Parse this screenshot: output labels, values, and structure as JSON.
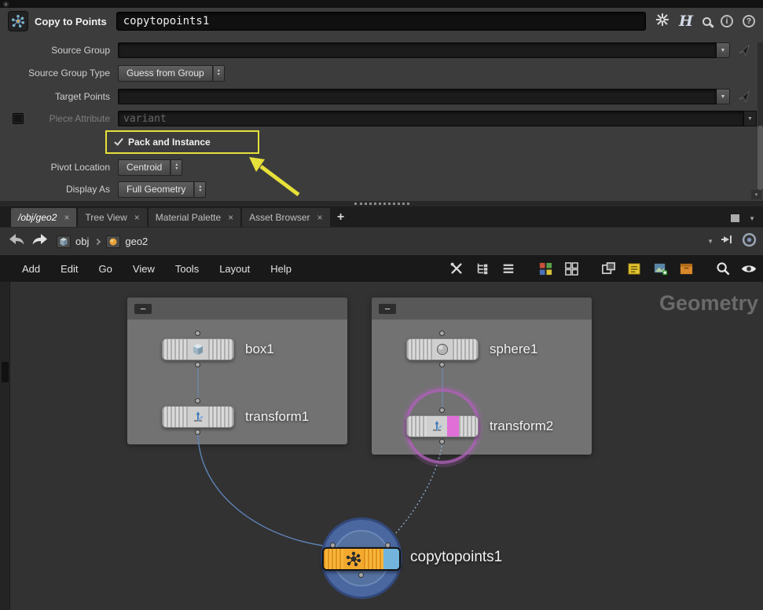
{
  "header": {
    "type_label": "Copy to Points",
    "name_value": "copytopoints1"
  },
  "parameters": {
    "source_group": {
      "label": "Source Group",
      "value": ""
    },
    "source_group_type": {
      "label": "Source Group Type",
      "value": "Guess from Group"
    },
    "target_points": {
      "label": "Target Points",
      "value": ""
    },
    "piece_attribute": {
      "label": "Piece Attribute",
      "value": "variant"
    },
    "pack_and_instance": {
      "label": "Pack and Instance",
      "checked": true
    },
    "pivot_location": {
      "label": "Pivot Location",
      "value": "Centroid"
    },
    "display_as": {
      "label": "Display As",
      "value": "Full Geometry"
    }
  },
  "glyphs": {
    "dropdown": "▼",
    "spin_up": "▴",
    "spin_down": "▾",
    "close": "×",
    "plus": "+",
    "minus": "−"
  },
  "tabs": {
    "items": [
      {
        "label": "/obj/geo2",
        "active": true
      },
      {
        "label": "Tree View",
        "active": false
      },
      {
        "label": "Material Palette",
        "active": false
      },
      {
        "label": "Asset Browser",
        "active": false
      }
    ]
  },
  "path_bar": {
    "segments": [
      {
        "label": "obj"
      },
      {
        "label": "geo2"
      }
    ]
  },
  "menu": {
    "items": [
      "Add",
      "Edit",
      "Go",
      "View",
      "Tools",
      "Layout",
      "Help"
    ]
  },
  "network": {
    "watermark": "Geometry",
    "nodes": {
      "box1": "box1",
      "transform1": "transform1",
      "sphere1": "sphere1",
      "transform2": "transform2",
      "copytopoints1": "copytopoints1"
    }
  },
  "colors": {
    "annotation_yellow": "#e6e03a",
    "node_orange": "#f0a232",
    "selection_blue": "#4a67a0",
    "template_purple": "#af5fb9",
    "segment_pink": "#e06fd8"
  }
}
